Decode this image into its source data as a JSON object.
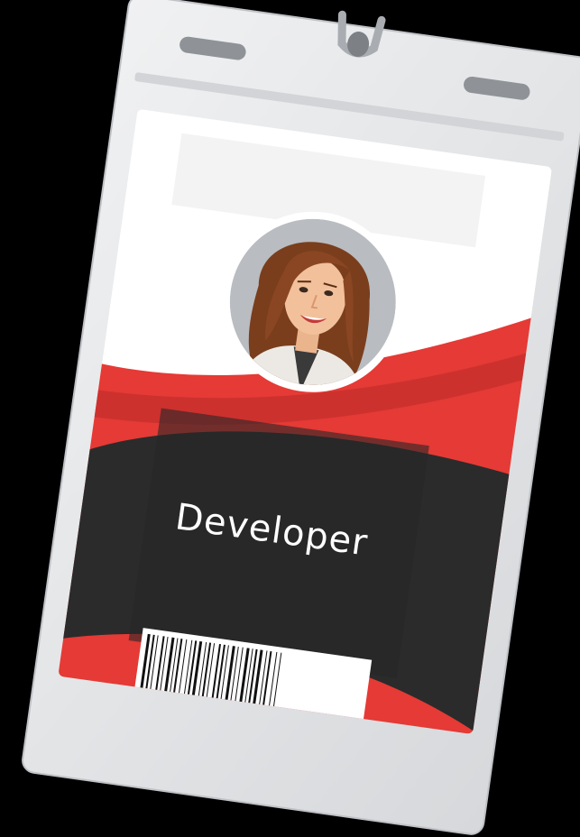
{
  "badge": {
    "role_label": "Developer",
    "colors": {
      "background": "#000000",
      "holder": "#e3e4e6",
      "holder_inner": "#d7d9dc",
      "card_white": "#ffffff",
      "accent_red": "#e53a35",
      "accent_red_dark": "#b82a28",
      "card_dark": "#2b2b2b",
      "role_text": "#ffffff"
    },
    "avatar": {
      "icon": "woman-avatar-icon",
      "hair_color": "#7a3e1d",
      "skin_color": "#f2c19b",
      "ring_color": "#ffffff",
      "backdrop_color": "#b9bcc0"
    },
    "barcode": {
      "icon": "barcode-icon"
    },
    "lanyard": {
      "icon": "lanyard-clip-icon"
    }
  }
}
